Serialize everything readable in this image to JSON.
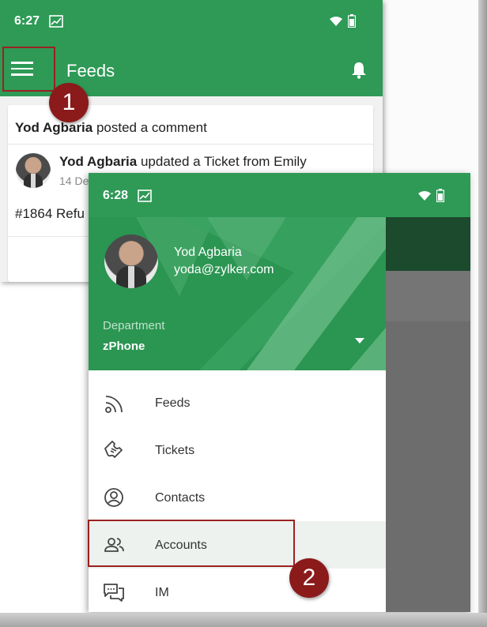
{
  "screen1": {
    "status": {
      "time": "6:27"
    },
    "appbar": {
      "title": "Feeds"
    },
    "feed": {
      "item1": {
        "author": "Yod Agbaria",
        "action": " posted a comment"
      },
      "item2": {
        "author": "Yod Agbaria",
        "action": " updated a Ticket from Emily",
        "date": "14 De",
        "text": "#1864 Refu"
      }
    },
    "badge": "1"
  },
  "screen2": {
    "status": {
      "time": "6:28"
    },
    "profile": {
      "name": "Yod Agbaria",
      "email": "yoda@zylker.com"
    },
    "department": {
      "label": "Department",
      "value": "zPhone"
    },
    "menu": [
      {
        "label": "Feeds",
        "icon": "rss-feed-icon"
      },
      {
        "label": "Tickets",
        "icon": "ticket-icon"
      },
      {
        "label": "Contacts",
        "icon": "contact-circle-icon"
      },
      {
        "label": "Accounts",
        "icon": "people-icon"
      },
      {
        "label": "IM",
        "icon": "chat-icon"
      }
    ],
    "badge": "2"
  },
  "colors": {
    "primary": "#2e9a56",
    "annotation": "#8b1a1a",
    "selected_row": "#eef2ef"
  }
}
